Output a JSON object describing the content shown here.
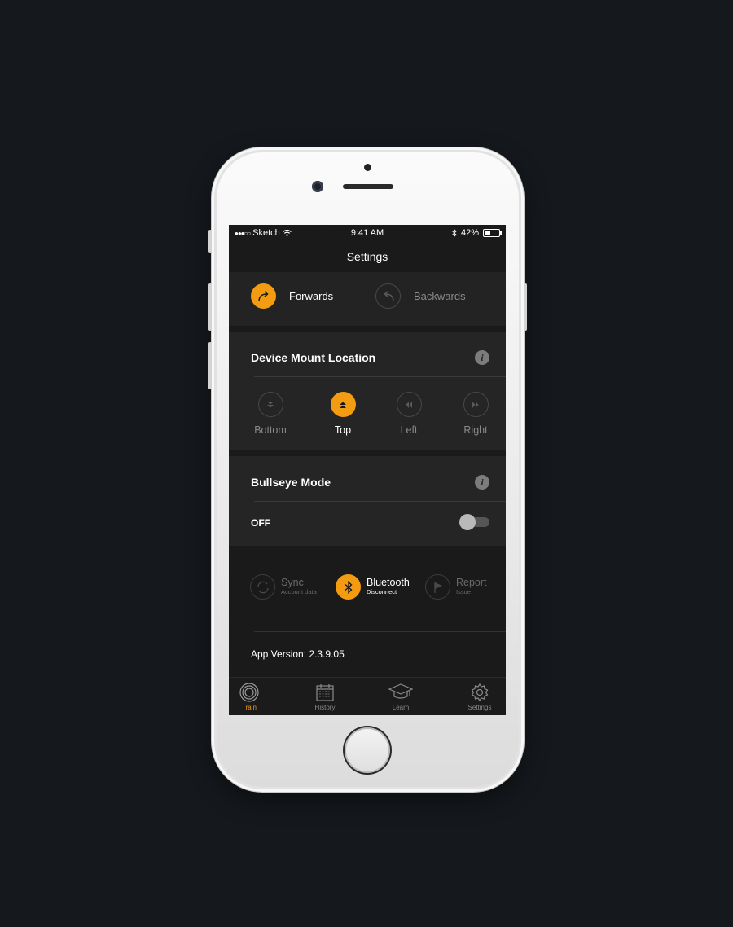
{
  "status_bar": {
    "carrier": "Sketch",
    "time": "9:41 AM",
    "battery": "42%",
    "battery_level": 0.42
  },
  "nav": {
    "title": "Settings"
  },
  "direction": {
    "forwards": {
      "label": "Forwards",
      "selected": true
    },
    "backwards": {
      "label": "Backwards",
      "selected": false
    }
  },
  "mount": {
    "title": "Device Mount Location",
    "options": [
      {
        "label": "Bottom",
        "selected": false
      },
      {
        "label": "Top",
        "selected": true
      },
      {
        "label": "Left",
        "selected": false
      },
      {
        "label": "Right",
        "selected": false
      }
    ]
  },
  "bullseye": {
    "title": "Bullseye Mode",
    "state_label": "OFF"
  },
  "actions": {
    "sync": {
      "title": "Sync",
      "subtitle": "Account data"
    },
    "bluetooth": {
      "title": "Bluetooth",
      "subtitle": "Disconnect"
    },
    "report": {
      "title": "Report",
      "subtitle": "Issue"
    }
  },
  "app_version": "App Version: 2.3.9.05",
  "tabs": [
    {
      "label": "Train",
      "icon": "target-icon",
      "active": true
    },
    {
      "label": "History",
      "icon": "calendar-icon",
      "active": false
    },
    {
      "label": "Learn",
      "icon": "graduation-cap-icon",
      "active": false
    },
    {
      "label": "Settings",
      "icon": "gear-icon",
      "active": false
    }
  ],
  "colors": {
    "accent": "#f39c12",
    "background": "#15181d",
    "panel": "#252525",
    "inactive": "#8a8a8a"
  }
}
